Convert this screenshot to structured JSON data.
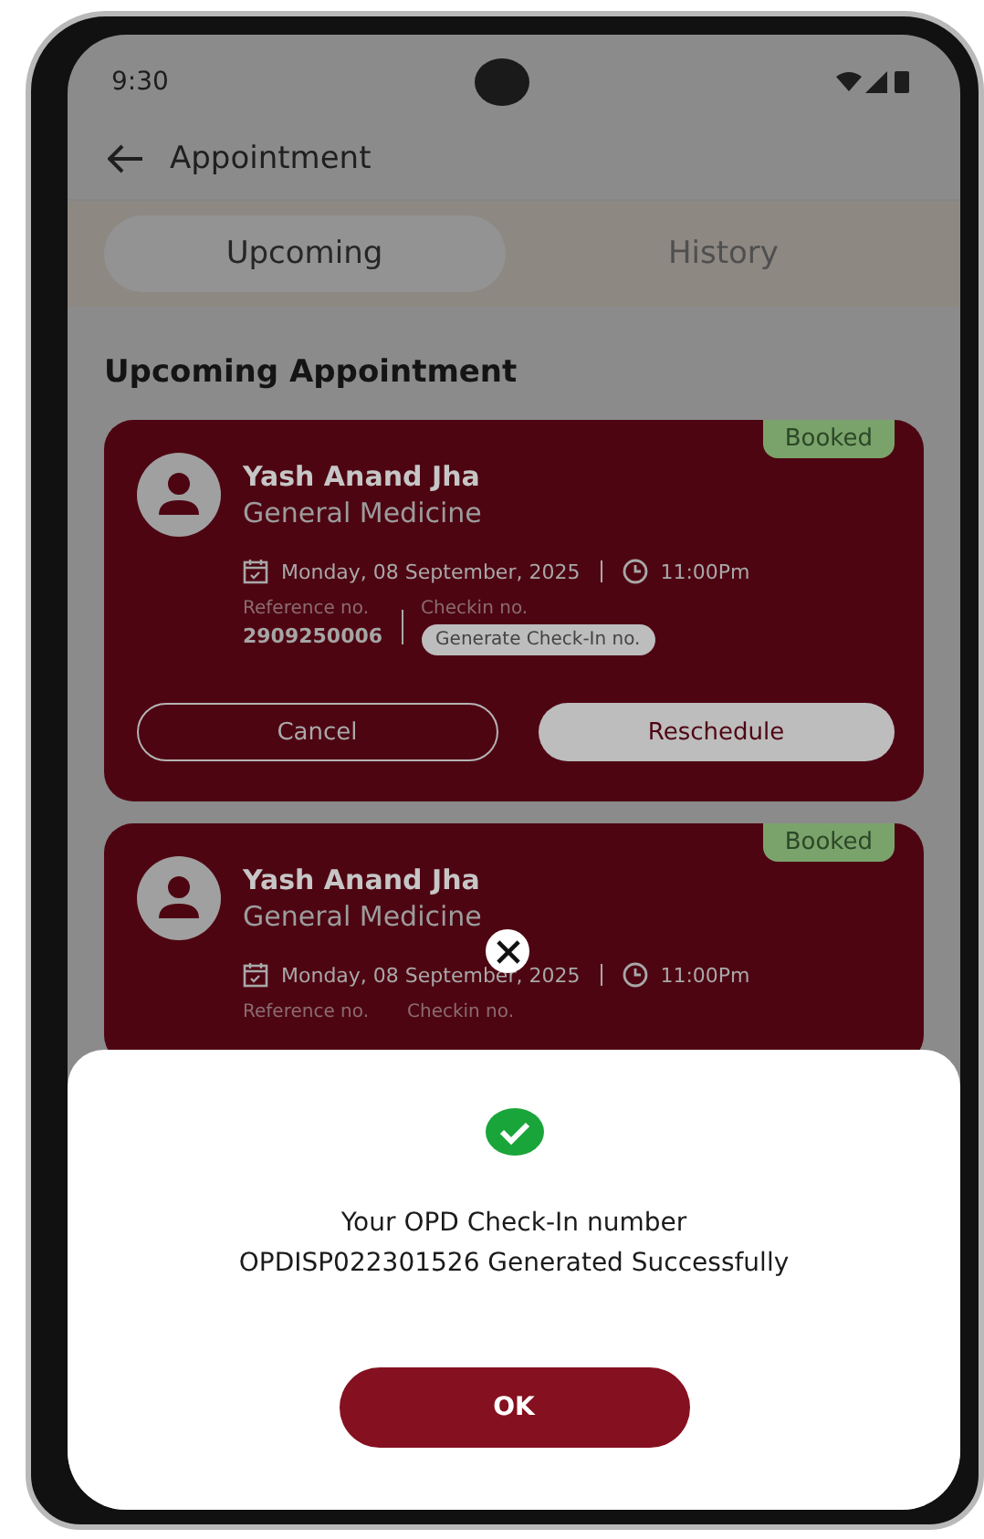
{
  "status_bar": {
    "time": "9:30"
  },
  "header": {
    "title": "Appointment"
  },
  "tabs": [
    {
      "label": "Upcoming",
      "selected": true
    },
    {
      "label": "History",
      "selected": false
    }
  ],
  "section_title": "Upcoming Appointment",
  "appointments": [
    {
      "name": "Yash Anand Jha",
      "specialty": "General Medicine",
      "status": "Booked",
      "date": "Monday, 08 September, 2025",
      "time": "11:00Pm",
      "reference_label": "Reference no.",
      "reference_value": "2909250006",
      "checkin_label": "Checkin no.",
      "checkin_action": "Generate Check-In no.",
      "actions": [
        "Cancel",
        "Reschedule"
      ]
    },
    {
      "name": "Yash Anand Jha",
      "specialty": "General Medicine",
      "status": "Booked",
      "date": "Monday, 08 September, 2025",
      "time": "11:00Pm",
      "reference_label": "Reference no.",
      "checkin_label": "Checkin no."
    }
  ],
  "dialog": {
    "message_lines": [
      "Your OPD Check-In number",
      "OPDISP022301526 Generated Successfully"
    ],
    "button": "OK"
  }
}
